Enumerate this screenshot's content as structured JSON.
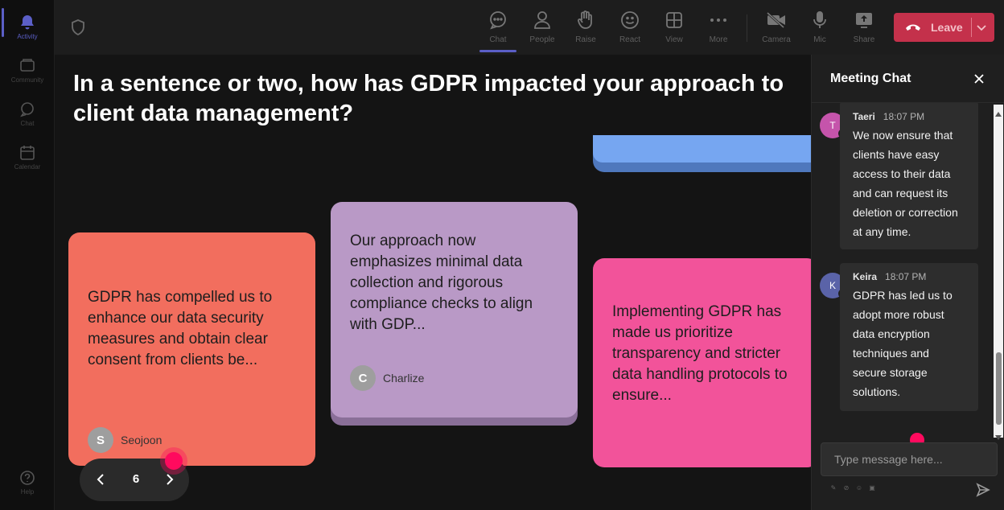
{
  "rail": {
    "items": [
      {
        "label": "Activity",
        "icon": "bell-icon"
      },
      {
        "label": "Community",
        "icon": "community-icon"
      },
      {
        "label": "Chat",
        "icon": "chat-icon"
      },
      {
        "label": "Calendar",
        "icon": "calendar-icon"
      },
      {
        "label": "Help",
        "icon": "help-icon"
      }
    ]
  },
  "toolbar": {
    "chat": "Chat",
    "people": "People",
    "raise": "Raise",
    "react": "React",
    "view": "View",
    "more": "More",
    "camera": "Camera",
    "mic": "Mic",
    "share": "Share",
    "leave": "Leave"
  },
  "stage": {
    "question": "In a sentence or two, how has GDPR impacted your approach to client data management?",
    "cards": [
      {
        "text": "GDPR has compelled us to enhance our data security measures and obtain clear consent from clients be...",
        "author": "Seojoon",
        "initial": "S",
        "color": "#f26e5e"
      },
      {
        "text": "Our approach now emphasizes minimal data collection and rigorous compliance checks to align with GDP...",
        "author": "Charlize",
        "initial": "C",
        "color": "#b999c6"
      },
      {
        "text": "Implementing GDPR has made us prioritize transparency and stricter data handling protocols to ensure...",
        "color": "#f2539a"
      }
    ],
    "pager": {
      "page": "6"
    }
  },
  "chat": {
    "title": "Meeting Chat",
    "messages": [
      {
        "initial": "T",
        "name": "Taeri",
        "time": "18:07 PM",
        "text": "We now ensure that clients have easy access to their data and can request its deletion or correction at any time.",
        "color": "#c554ab"
      },
      {
        "initial": "K",
        "name": "Keira",
        "time": "18:07 PM",
        "text": "GDPR has led us to adopt more robust data encryption techniques and secure storage solutions.",
        "color": "#5a63a8"
      }
    ],
    "placeholder": "Type message here..."
  },
  "colors": {
    "accent": "#5b5fc7",
    "leave": "#c4314b",
    "cursor": "#ff0a5e"
  }
}
